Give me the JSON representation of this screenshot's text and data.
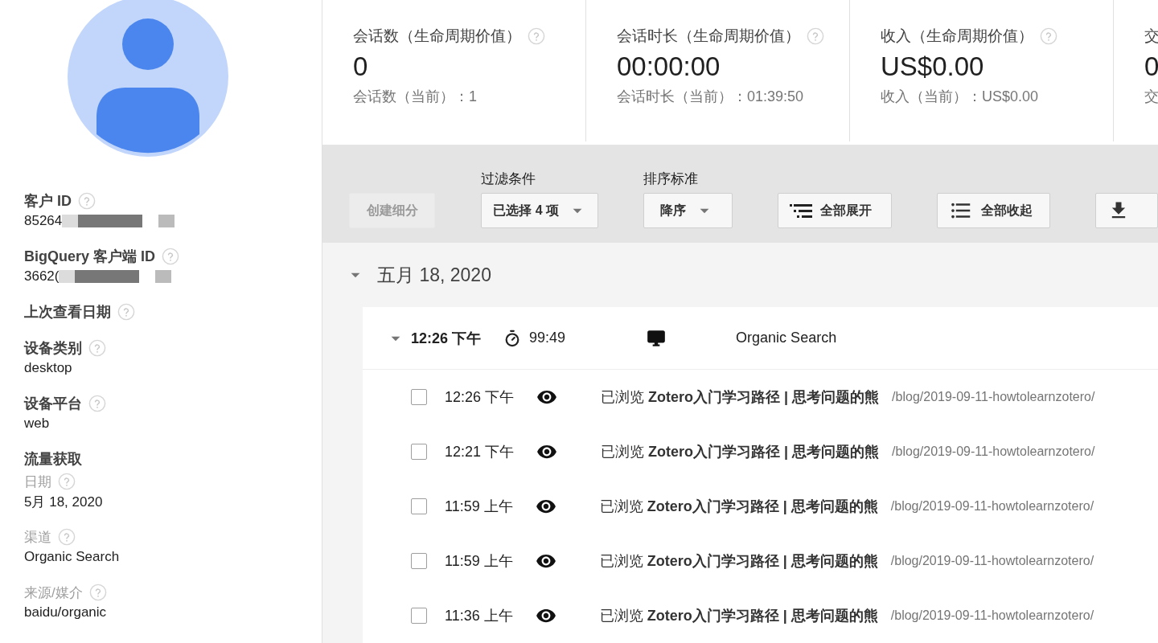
{
  "profile": {
    "fields": [
      {
        "kind": "field",
        "label": "客户 ID",
        "help": true,
        "value": "85264",
        "redacted": true
      },
      {
        "kind": "field",
        "label": "BigQuery 客户端 ID",
        "help": true,
        "value": "3662(",
        "redacted": true
      },
      {
        "kind": "field",
        "label": "上次查看日期",
        "help": true
      },
      {
        "kind": "field",
        "label": "设备类别",
        "help": true,
        "value": "desktop",
        "redacted": false
      },
      {
        "kind": "field",
        "label": "设备平台",
        "help": true,
        "value": "web",
        "redacted": false
      },
      {
        "kind": "section",
        "label": "流量获取",
        "help": false
      },
      {
        "kind": "subfield",
        "label": "日期",
        "help": true,
        "value": "5月 18, 2020",
        "redacted": false
      },
      {
        "kind": "subfield",
        "label": "渠道",
        "help": true,
        "value": "Organic Search",
        "redacted": false
      },
      {
        "kind": "subfield",
        "label": "来源/媒介",
        "help": true,
        "value": "baidu/organic",
        "redacted": false
      }
    ]
  },
  "metrics": [
    {
      "title": "会话数（生命周期价值）",
      "help": true,
      "value": "0",
      "sub": "会话数（当前）：1"
    },
    {
      "title": "会话时长（生命周期价值）",
      "help": true,
      "value": "00:00:00",
      "sub": "会话时长（当前）：01:39:50"
    },
    {
      "title": "收入（生命周期价值）",
      "help": true,
      "value": "US$0.00",
      "sub": "收入（当前）：US$0.00"
    },
    {
      "title": "交",
      "value": "0",
      "sub": "交"
    }
  ],
  "toolbar": {
    "create_segment": {
      "label": "创建细分",
      "disabled": true
    },
    "filter": {
      "label": "过滤条件",
      "value": "已选择 4 项"
    },
    "sort": {
      "label": "排序标准",
      "value": "降序"
    },
    "buttons": [
      {
        "kind": "expand",
        "label": "全部展开"
      },
      {
        "kind": "collapse",
        "label": "全部收起"
      },
      {
        "kind": "download"
      }
    ]
  },
  "date_group": {
    "label": "五月 18, 2020",
    "expanded": true,
    "session": {
      "time": "12:26 下午",
      "duration": "99:49",
      "source": "Organic Search",
      "expanded": true,
      "events": [
        {
          "checked": false,
          "time": "12:26 下午",
          "text": "已浏览 **Zotero入门学习路径 | 思考问题的熊**",
          "path": "/blog/2019-09-11-howtolearnzotero/"
        },
        {
          "checked": false,
          "time": "12:21 下午",
          "text": "已浏览 **Zotero入门学习路径 | 思考问题的熊**",
          "path": "/blog/2019-09-11-howtolearnzotero/"
        },
        {
          "checked": false,
          "time": "11:59 上午",
          "text": "已浏览 **Zotero入门学习路径 | 思考问题的熊**",
          "path": "/blog/2019-09-11-howtolearnzotero/"
        },
        {
          "checked": false,
          "time": "11:59 上午",
          "text": "已浏览 **Zotero入门学习路径 | 思考问题的熊**",
          "path": "/blog/2019-09-11-howtolearnzotero/"
        },
        {
          "checked": false,
          "time": "11:36 上午",
          "text": "已浏览 **Zotero入门学习路径 | 思考问题的熊**",
          "path": "/blog/2019-09-11-howtolearnzotero/"
        }
      ]
    }
  }
}
